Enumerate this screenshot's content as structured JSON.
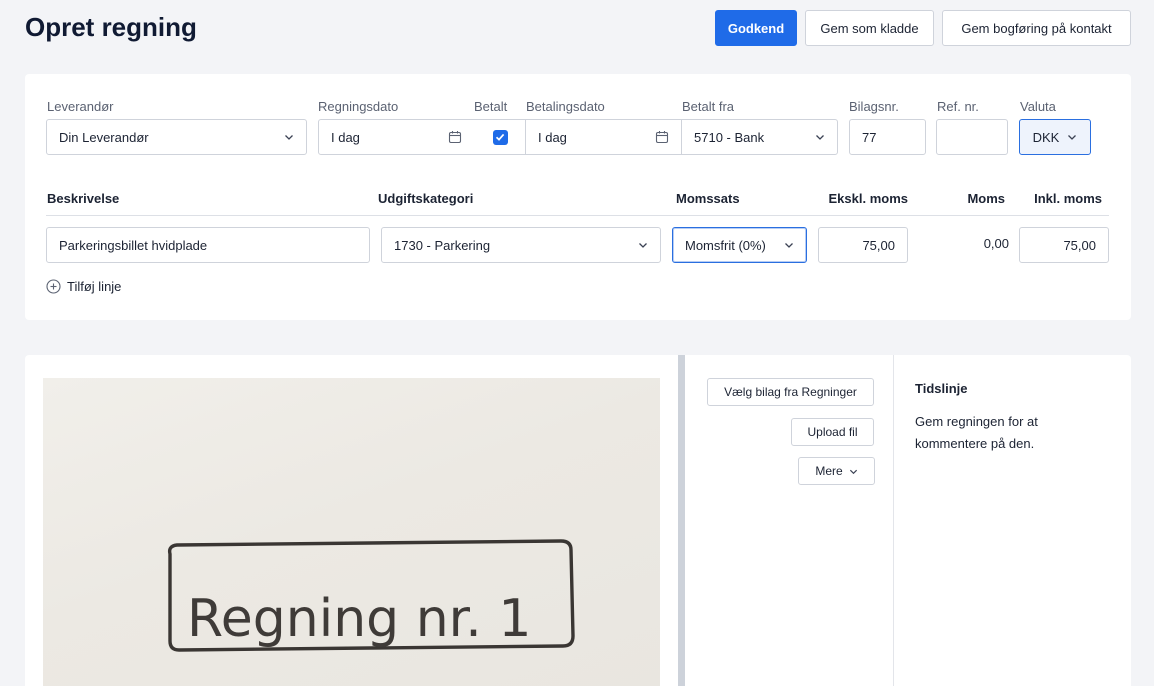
{
  "page": {
    "title": "Opret regning"
  },
  "actions": {
    "approve": "Godkend",
    "save_draft": "Gem som kladde",
    "save_posting": "Gem bogføring på kontakt"
  },
  "header_fields": {
    "supplier": {
      "label": "Leverandør",
      "value": "Din Leverandør"
    },
    "bill_date": {
      "label": "Regningsdato",
      "value": "I dag"
    },
    "paid": {
      "label": "Betalt",
      "checked": true
    },
    "payment_date": {
      "label": "Betalingsdato",
      "value": "I dag"
    },
    "paid_from": {
      "label": "Betalt fra",
      "value": "5710 - Bank"
    },
    "voucher_no": {
      "label": "Bilagsnr.",
      "value": "77"
    },
    "ref_no": {
      "label": "Ref. nr.",
      "value": ""
    },
    "currency": {
      "label": "Valuta",
      "value": "DKK"
    }
  },
  "lines": {
    "headers": {
      "description": "Beskrivelse",
      "expense_category": "Udgiftskategori",
      "vat_rate": "Momssats",
      "excl_vat": "Ekskl. moms",
      "vat": "Moms",
      "incl_vat": "Inkl. moms"
    },
    "rows": [
      {
        "description": "Parkeringsbillet hvidplade",
        "category": "1730 - Parkering",
        "vat_rate": "Momsfrit (0%)",
        "excl_vat": "75,00",
        "vat": "0,00",
        "incl_vat": "75,00"
      }
    ],
    "add_line": "Tilføj linje"
  },
  "attachments": {
    "choose_from_bills": "Vælg bilag fra Regninger",
    "upload": "Upload fil",
    "more": "Mere",
    "receipt_text": "Regning nr. 1"
  },
  "timeline": {
    "title": "Tidslinje",
    "text": "Gem regningen for at kommentere på den."
  },
  "colors": {
    "primary": "#1f6be8",
    "background": "#f3f4f7"
  }
}
